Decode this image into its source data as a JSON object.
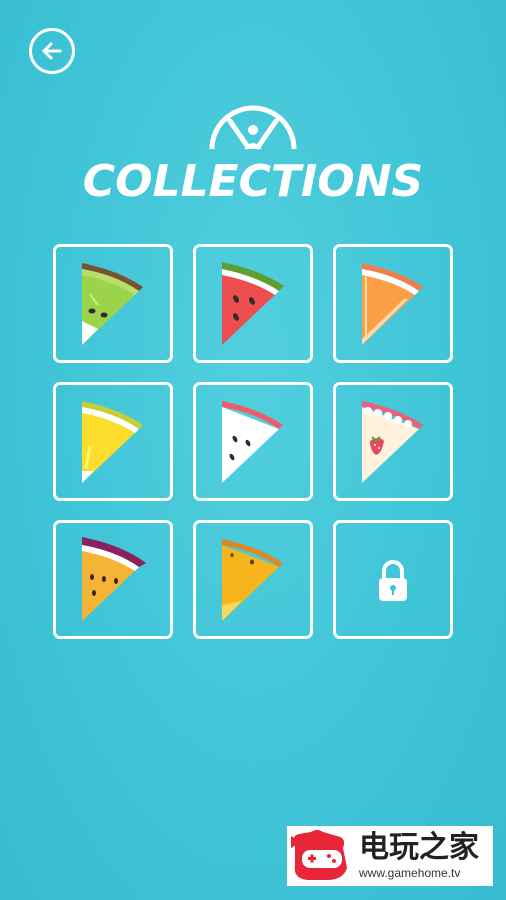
{
  "header": {
    "back_icon": "arrow-left-icon",
    "title": "COLLECTIONS",
    "emblem_icon": "pizza-cutter-emblem-icon"
  },
  "collections": [
    {
      "name": "kiwi",
      "locked": false,
      "rind": "#7a5230",
      "under": "#9ccf3a",
      "flesh": "#9bd34a",
      "accent": "#2c2c2c"
    },
    {
      "name": "watermelon",
      "locked": false,
      "rind": "#5f9e33",
      "under": "#ffffff",
      "flesh": "#ec4d4f",
      "accent": "#2c2c2c"
    },
    {
      "name": "orange",
      "locked": false,
      "rind": "#f07e4a",
      "under": "#ffffff",
      "flesh": "#f9a047",
      "accent": "#ffd9a8"
    },
    {
      "name": "lemon",
      "locked": false,
      "rind": "#c7cd34",
      "under": "#ffffff",
      "flesh": "#fddd2c",
      "accent": "#fff27a"
    },
    {
      "name": "coconut",
      "locked": false,
      "rind": "#ef5b66",
      "under": "#ffffff",
      "flesh": "#ffffff",
      "accent": "#2c2c2c"
    },
    {
      "name": "strawberry-cake",
      "locked": false,
      "rind": "#ee5f78",
      "under": "#ffffff",
      "flesh": "#fff1dc",
      "accent": "#e84b5d"
    },
    {
      "name": "dragon-fruit",
      "locked": false,
      "rind": "#8a2161",
      "under": "#ffffff",
      "flesh": "#f6b437",
      "accent": "#3a2318"
    },
    {
      "name": "mango",
      "locked": false,
      "rind": "#d98a24",
      "under": "#f8d75a",
      "flesh": "#f6b51d",
      "accent": "#5c3a12"
    },
    {
      "name": "locked",
      "locked": true,
      "icon": "lock-icon"
    }
  ],
  "watermark": {
    "text_cn": "电玩之家",
    "url": "www.gamehome.tv",
    "logo_color": "#e8263a"
  }
}
